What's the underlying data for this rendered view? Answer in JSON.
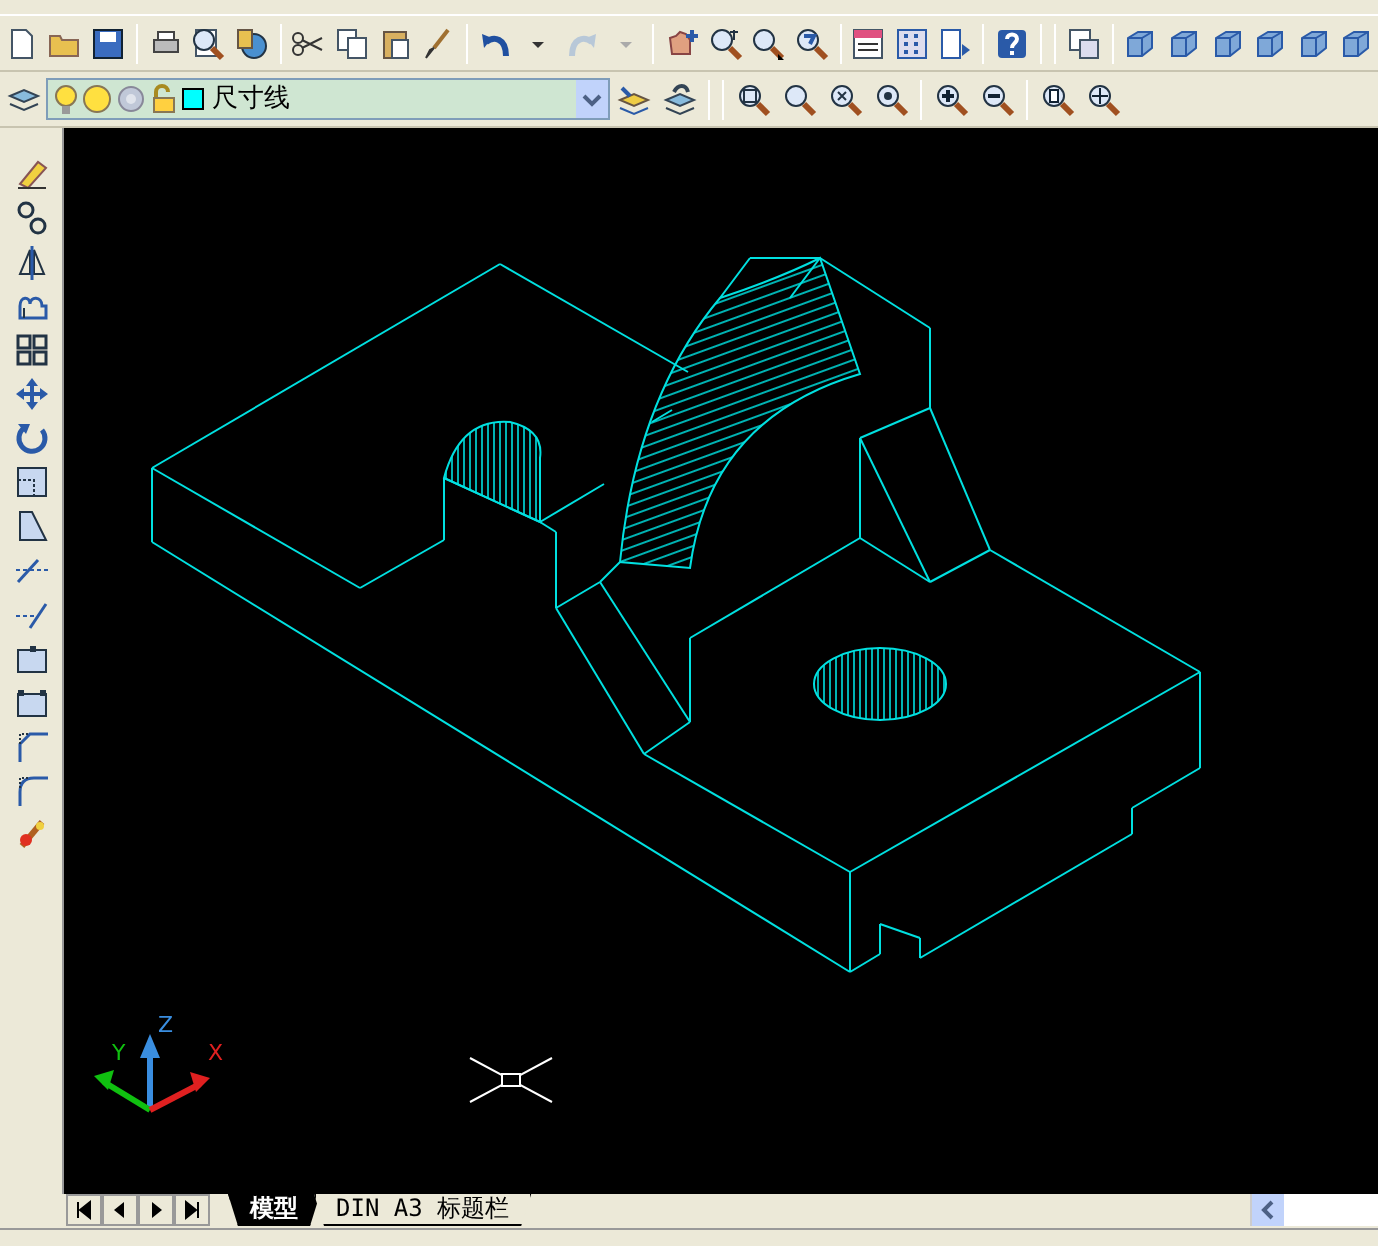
{
  "standard_toolbar": {
    "redo": {
      "disabled": true
    }
  },
  "layer_control": {
    "value": "尺寸线",
    "layer_on": true,
    "color": "#00ffff"
  },
  "ucs_icon": {
    "x_label": "X",
    "y_label": "Y",
    "z_label": "Z"
  },
  "layout_tabs": [
    {
      "label": "模型",
      "selected": true
    },
    {
      "label": "DIN A3 标题栏",
      "selected": false
    }
  ]
}
